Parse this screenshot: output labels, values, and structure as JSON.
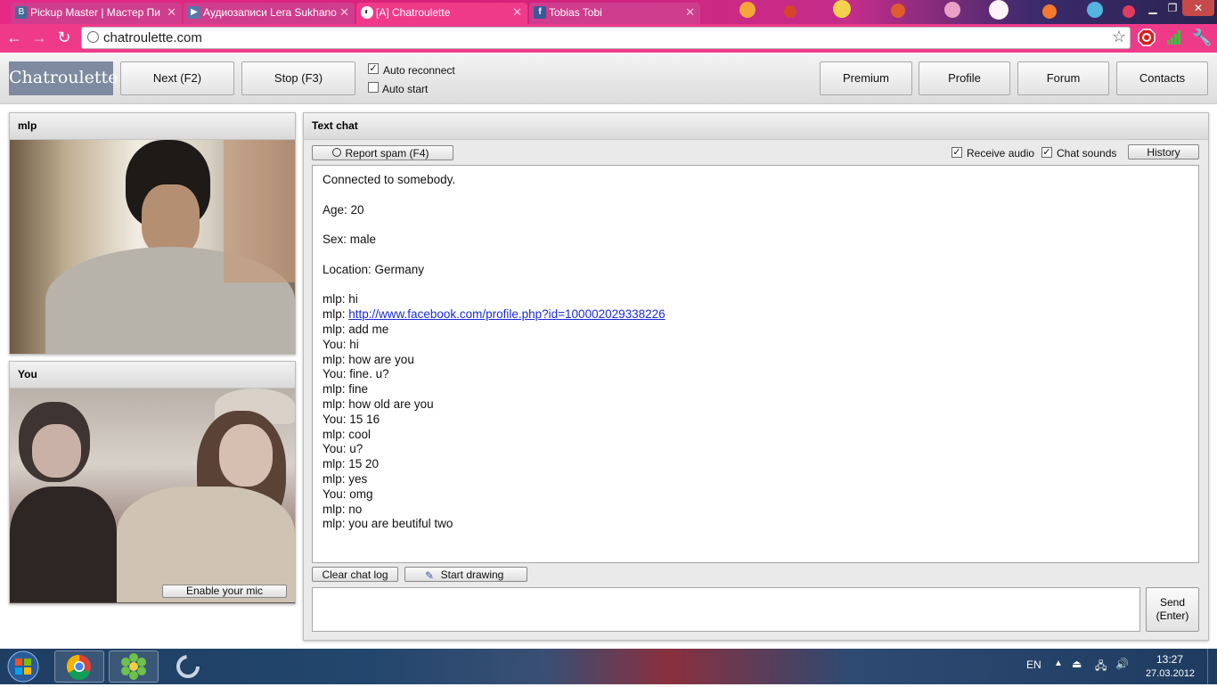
{
  "browser": {
    "tabs": [
      {
        "label": "Pickup Master | Мастер Пи",
        "icon": "vk-icon",
        "icon_glyph": "B",
        "icon_color": "#4a6a96"
      },
      {
        "label": "Аудиозаписи Lera Sukhano",
        "icon": "play-icon",
        "icon_glyph": "▶",
        "icon_color": "#5878a8"
      },
      {
        "label": "[A] Chatroulette",
        "icon": "chatroulette-icon",
        "icon_glyph": "◐",
        "icon_color": "#222222"
      },
      {
        "label": "Tobias Tobi",
        "icon": "facebook-icon",
        "icon_glyph": "f",
        "icon_color": "#3b5998"
      }
    ],
    "url": "chatroulette.com"
  },
  "header": {
    "logo": "Chatroulette",
    "next_label": "Next (F2)",
    "stop_label": "Stop (F3)",
    "auto_reconnect": {
      "label": "Auto reconnect",
      "checked": true
    },
    "auto_start": {
      "label": "Auto start",
      "checked": false
    },
    "nav": [
      "Premium",
      "Profile",
      "Forum",
      "Contacts"
    ]
  },
  "partner_panel": {
    "title": "mlp"
  },
  "self_panel": {
    "title": "You",
    "mic_button": "Enable your mic"
  },
  "chat": {
    "title": "Text chat",
    "report_spam": "Report spam (F4)",
    "receive_audio": {
      "label": "Receive audio",
      "checked": true
    },
    "chat_sounds": {
      "label": "Chat sounds",
      "checked": true
    },
    "history": "History",
    "info": [
      "Connected to somebody.",
      "Age: 20",
      "Sex: male",
      "Location: Germany"
    ],
    "messages": [
      {
        "who": "mlp",
        "text": "hi"
      },
      {
        "who": "mlp",
        "text": "http://www.facebook.com/profile.php?id=100002029338226",
        "link": true
      },
      {
        "who": "mlp",
        "text": "add me"
      },
      {
        "who": "You",
        "text": "hi"
      },
      {
        "who": "mlp",
        "text": "how are you"
      },
      {
        "who": "You",
        "text": "fine. u?"
      },
      {
        "who": "mlp",
        "text": "fine"
      },
      {
        "who": "mlp",
        "text": "how old are you"
      },
      {
        "who": "You",
        "text": "15 16"
      },
      {
        "who": "mlp",
        "text": "cool"
      },
      {
        "who": "You",
        "text": "u?"
      },
      {
        "who": "mlp",
        "text": "15 20"
      },
      {
        "who": "mlp",
        "text": "yes"
      },
      {
        "who": "You",
        "text": "omg"
      },
      {
        "who": "mlp",
        "text": "no"
      },
      {
        "who": "mlp",
        "text": "you are beutiful two"
      }
    ],
    "clear_log": "Clear chat log",
    "start_drawing": "Start drawing",
    "send_line1": "Send",
    "send_line2": "(Enter)"
  },
  "taskbar": {
    "language": "EN",
    "time": "13:27",
    "date": "27.03.2012"
  },
  "colors": {
    "tab_bar": "#e52a86",
    "toolbar": "#ef3a8a",
    "logo_bg": "#7e8aa0",
    "link": "#1a2bd6"
  }
}
